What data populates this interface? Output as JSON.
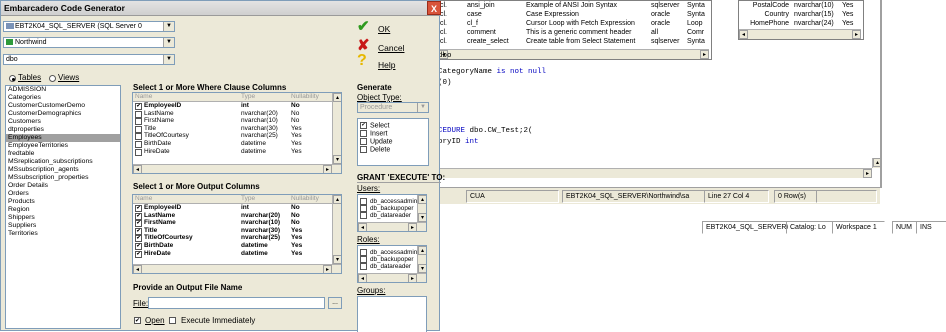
{
  "dialog": {
    "title": "Embarcadero Code Generator",
    "close_glyph": "X",
    "datasource_combo": "EBT2K04_SQL_SERVER (SQL Server 0",
    "database_combo": "Northwind",
    "owner_combo": "dbo",
    "ok_label": "OK",
    "cancel_label": "Cancel",
    "help_label": "Help",
    "tables_radio": "Tables",
    "views_radio": "Views",
    "object_list": [
      "ADMISSION",
      "Categories",
      "CustomerCustomerDemo",
      "CustomerDemographics",
      "Customers",
      "dtproperties",
      "Employees",
      "EmployeeTerritories",
      "fredtable",
      "MSreplication_subscriptions",
      "MSsubscription_agents",
      "MSsubscription_properties",
      "Order Details",
      "Orders",
      "Products",
      "Region",
      "Shippers",
      "Suppliers",
      "Territories"
    ],
    "selected_object": "Employees",
    "where_title": "Select 1 or More Where Clause Columns",
    "output_title": "Select 1 or More Output Columns",
    "grid_headers": {
      "name": "Name",
      "type": "Type",
      "nullability": "Nullability"
    },
    "where_rows": [
      {
        "name": "EmployeeID",
        "type": "int",
        "null": "No",
        "checked": true
      },
      {
        "name": "LastName",
        "type": "nvarchar(20)",
        "null": "No",
        "checked": false
      },
      {
        "name": "FirstName",
        "type": "nvarchar(10)",
        "null": "No",
        "checked": false
      },
      {
        "name": "Title",
        "type": "nvarchar(30)",
        "null": "Yes",
        "checked": false
      },
      {
        "name": "TitleOfCourtesy",
        "type": "nvarchar(25)",
        "null": "Yes",
        "checked": false
      },
      {
        "name": "BirthDate",
        "type": "datetime",
        "null": "Yes",
        "checked": false
      },
      {
        "name": "HireDate",
        "type": "datetime",
        "null": "Yes",
        "checked": false
      }
    ],
    "output_rows": [
      {
        "name": "EmployeeID",
        "type": "int",
        "null": "No",
        "checked": true
      },
      {
        "name": "LastName",
        "type": "nvarchar(20)",
        "null": "No",
        "checked": true
      },
      {
        "name": "FirstName",
        "type": "nvarchar(10)",
        "null": "No",
        "checked": true
      },
      {
        "name": "Title",
        "type": "nvarchar(30)",
        "null": "Yes",
        "checked": true
      },
      {
        "name": "TitleOfCourtesy",
        "type": "nvarchar(25)",
        "null": "Yes",
        "checked": true
      },
      {
        "name": "BirthDate",
        "type": "datetime",
        "null": "Yes",
        "checked": true
      },
      {
        "name": "HireDate",
        "type": "datetime",
        "null": "Yes",
        "checked": true
      }
    ],
    "generate_title": "Generate",
    "object_type_label": "Object Type:",
    "object_type_value": "Procedure",
    "statement_options": [
      {
        "label": "Select",
        "checked": true
      },
      {
        "label": "Insert",
        "checked": false
      },
      {
        "label": "Update",
        "checked": false
      },
      {
        "label": "Delete",
        "checked": false
      }
    ],
    "grant_title": "GRANT 'EXECUTE' TO:",
    "users_label": "Users:",
    "users": [
      "db_accessadmin",
      "db_backupoper",
      "db_datareader"
    ],
    "roles_label": "Roles:",
    "roles": [
      "db_accessadmin",
      "db_backupoper",
      "db_datareader"
    ],
    "groups_label": "Groups:",
    "output_file_title": "Provide an Output File Name",
    "file_label": "File:",
    "browse_label": "...",
    "open_label": "Open",
    "open_checked": true,
    "execute_label": "Execute Immediately",
    "execute_checked": false
  },
  "background": {
    "snippets": [
      {
        "prefix": "cl.",
        "name": "ansi_join",
        "desc": "Example of ANSI Join Syntax",
        "db": "sqlserver",
        "kind": "Synta"
      },
      {
        "prefix": "cl.",
        "name": "case",
        "desc": "Case Expression",
        "db": "oracle",
        "kind": "Synta"
      },
      {
        "prefix": "cl.",
        "name": "cl_f",
        "desc": "Cursor Loop with Fetch Expression",
        "db": "oracle",
        "kind": "Loop"
      },
      {
        "prefix": "cl.",
        "name": "comment",
        "desc": "This is a generic comment header",
        "db": "all",
        "kind": "Comr"
      },
      {
        "prefix": "cl.",
        "name": "create_select",
        "desc": "Create table from Select Statement",
        "db": "sqlserver",
        "kind": "Synta"
      }
    ],
    "columns_grid": [
      {
        "name": "PostalCode",
        "type": "nvarchar(10)",
        "null": "Yes"
      },
      {
        "name": "Country",
        "type": "nvarchar(15)",
        "null": "Yes"
      },
      {
        "name": "HomePhone",
        "type": "nvarchar(24)",
        "null": "Yes"
      }
    ],
    "code_lines": {
      "dbo": "dbo",
      "category_line": "CategoryName ",
      "is_not_null": "is not null",
      "zero": "(0)",
      "create_proc_kw": "CEDURE",
      "create_proc_rest": " dbo.CW_Test;2(",
      "param_line": "oryID ",
      "param_type": "int"
    },
    "status1": {
      "cua": "CUA",
      "conn": "EBT2K04_SQL_SERVER\\Northwind\\sa",
      "pos": "Line 27 Col 4",
      "rows": "0 Row(s)"
    },
    "status2": {
      "conn": "EBT2K04_SQL_SERVER\\N",
      "catalog": "Catalog: Lo",
      "workspace": "Workspace 1",
      "num": "NUM",
      "ins": "INS"
    }
  }
}
